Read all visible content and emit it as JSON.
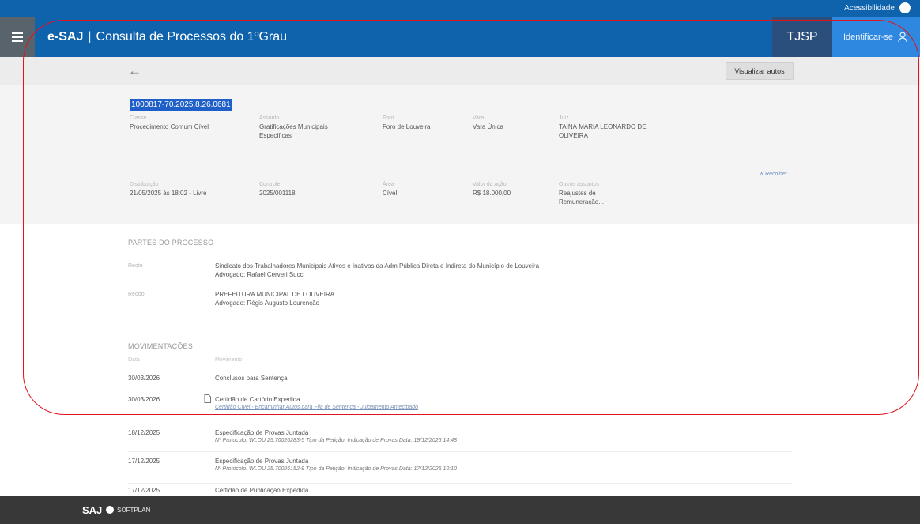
{
  "topbar": {
    "accessibility_label": "Acessibilidade"
  },
  "navbar": {
    "brand": "e-SAJ",
    "separator": "|",
    "title": "Consulta de Processos do 1ºGrau",
    "tjsp": "TJSP",
    "identify": "Identificar-se"
  },
  "subbar": {
    "back_symbol": "←",
    "view_docs_button": "Visualizar autos"
  },
  "process": {
    "number": "1000817-70.2025.8.26.0681",
    "fields": [
      {
        "label": "Classe",
        "value": "Procedimento Comum Cível"
      },
      {
        "label": "Assunto",
        "value": "Gratificações Municipais Específicas"
      },
      {
        "label": "Foro",
        "value": "Foro de Louveira"
      },
      {
        "label": "Vara",
        "value": "Vara Única"
      },
      {
        "label": "Juiz",
        "value": "TAINÁ MARIA LEONARDO DE OLIVEIRA"
      },
      {
        "label": "Distribuição",
        "value": "21/05/2025 às 18:02 - Livre"
      },
      {
        "label": "Controle",
        "value": "2025/001118"
      },
      {
        "label": "Área",
        "value": "Cível"
      },
      {
        "label": "Valor da ação",
        "value": "R$ 18.000,00"
      },
      {
        "label": "Outros assuntos",
        "value": "Reajustes de Remuneração..."
      }
    ],
    "collapse_link": "∧ Recolher"
  },
  "parties": {
    "title": "PARTES DO PROCESSO",
    "items": [
      {
        "role": "Reqte",
        "name": "Sindicato dos Trabalhadores Municipais Ativos e Inativos da Adm Pública Direta e Indireta do Município de Louveira",
        "lawyer": "Advogado: Rafael Cerveri Succi"
      },
      {
        "role": "Reqdo",
        "name": "PREFEITURA MUNICIPAL DE LOUVEIRA",
        "lawyer": "Advogado: Régis Augusto Lourenção"
      }
    ]
  },
  "movements": {
    "title": "MOVIMENTAÇÕES",
    "col_date": "Data",
    "col_movement": "Movimento",
    "rows": [
      {
        "date": "30/03/2026",
        "text": "Conclusos para Sentença",
        "sub": ""
      },
      {
        "date": "30/03/2026",
        "text": "Certidão de Cartório Expedida",
        "sub": "Certidão Cível - Encaminhar Autos para Fila de Sentença - Julgamento Antecipado",
        "doc_icon": "📄"
      },
      {
        "date": "18/12/2025",
        "text": "Especificação de Provas Juntada",
        "sub": "Nº Protocolo: WLOU.25.70026283-5 Tipo da Petição: Indicação de Provas Data: 18/12/2025 14:48"
      },
      {
        "date": "17/12/2025",
        "text": "Especificação de Provas Juntada",
        "sub": "Nº Protocolo: WLOU.25.70026152-9 Tipo da Petição: Indicação de Provas Data: 17/12/2025 10:10"
      },
      {
        "date": "17/12/2025",
        "text": "Certidão de Publicação Expedida",
        "sub": ""
      }
    ]
  },
  "footer": {
    "saj": "SAJ",
    "softplan": "SOFTPLAN"
  }
}
